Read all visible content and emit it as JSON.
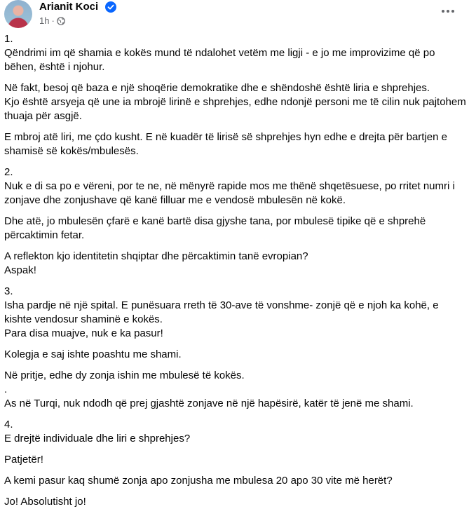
{
  "post": {
    "author": "Arianit Koci",
    "time": "1h",
    "separator": "·",
    "paragraphs": [
      {
        "text": "1.\nQëndrimi im që shamia e kokës mund të ndalohet vetëm me ligji - e jo me improvizime që po bëhen, është i njohur."
      },
      {
        "text": "Në fakt, besoj që baza e një shoqërie demokratike dhe e shëndoshë është liria e shprehjes.\nKjo është arsyeja që une ia mbrojë lirinë e shprehjes, edhe ndonjë personi me të cilin nuk pajtohem thuaja për asgjë."
      },
      {
        "text": "E mbroj atë liri, me çdo kusht. E në kuadër të lirisë së shprehjes hyn edhe e drejta për bartjen e shamisë së kokës/mbulesës."
      },
      {
        "text": "2.\nNuk e di sa po e vëreni, por te ne, në mënyrë rapide mos me thënë shqetësuese, po rritet numri i zonjave dhe zonjushave që kanë filluar me e vendosë mbulesën në kokë."
      },
      {
        "text": "Dhe atë, jo mbulesën çfarë e kanë bartë disa gjyshe tana, por mbulesë tipike që e shprehë përcaktimin fetar."
      },
      {
        "text": "A reflekton kjo identitetin shqiptar dhe përcaktimin tanë evropian?\nAspak!"
      },
      {
        "text": "3.\nIsha pardje në një spital. E punësuara rreth të 30-ave të vonshme- zonjë që e njoh ka kohë, e kishte vendosur shaminë e kokës.\nPara disa muajve, nuk e ka pasur!"
      },
      {
        "text": "Kolegja e saj ishte poashtu me shami."
      },
      {
        "text": "Në pritje, edhe dy zonja ishin me mbulesë të kokës.\n.\nAs në Turqi, nuk ndodh që prej gjashtë zonjave në një hapësirë, katër të jenë me shami."
      },
      {
        "text": "4.\nE drejtë individuale dhe liri e shprehjes?"
      },
      {
        "text": "Patjetër!"
      },
      {
        "text": "A kemi pasur kaq shumë zonja apo zonjusha me mbulesa 20 apo 30 vite më herët?"
      },
      {
        "text": "Jo! Absolutisht jo!"
      }
    ]
  },
  "icons": {
    "verified": "verified-badge-icon",
    "audience": "globe-icon",
    "more": "more-options-icon"
  },
  "colors": {
    "text": "#050505",
    "meta": "#65676b",
    "verified": "#0866ff"
  }
}
